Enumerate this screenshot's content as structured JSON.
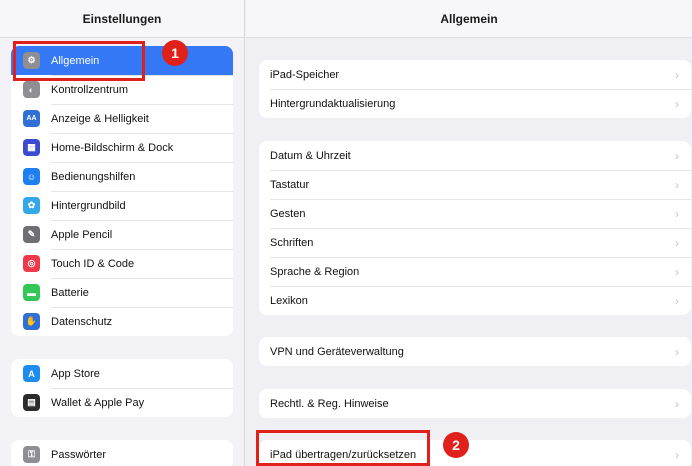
{
  "left_header": "Einstellungen",
  "right_header": "Allgemein",
  "sidebar": {
    "group1": [
      {
        "label": "Allgemein",
        "icon": "gear-icon",
        "color": "#8e8e93",
        "glyph": "⚙"
      },
      {
        "label": "Kontrollzentrum",
        "icon": "toggles-icon",
        "color": "#8e8e93",
        "glyph": "◐"
      },
      {
        "label": "Anzeige & Helligkeit",
        "icon": "text-size-icon",
        "color": "#2f6fd6",
        "glyph": "AA"
      },
      {
        "label": "Home-Bildschirm & Dock",
        "icon": "grid-icon",
        "color": "#3b4bd0",
        "glyph": "▦"
      },
      {
        "label": "Bedienungshilfen",
        "icon": "accessibility-icon",
        "color": "#1d7ff0",
        "glyph": "☺"
      },
      {
        "label": "Hintergrundbild",
        "icon": "flower-icon",
        "color": "#33a8e8",
        "glyph": "✿"
      },
      {
        "label": "Apple Pencil",
        "icon": "pencil-icon",
        "color": "#6e6e73",
        "glyph": "✎"
      },
      {
        "label": "Touch ID & Code",
        "icon": "fingerprint-icon",
        "color": "#ef3a4c",
        "glyph": "◎"
      },
      {
        "label": "Batterie",
        "icon": "battery-icon",
        "color": "#33c759",
        "glyph": "▬"
      },
      {
        "label": "Datenschutz",
        "icon": "hand-icon",
        "color": "#2f6fd6",
        "glyph": "✋"
      }
    ],
    "group2": [
      {
        "label": "App Store",
        "icon": "app-store-icon",
        "color": "#1d8cf0",
        "glyph": "A"
      },
      {
        "label": "Wallet & Apple Pay",
        "icon": "wallet-icon",
        "color": "#2b2b2b",
        "glyph": "▤"
      }
    ],
    "group3": [
      {
        "label": "Passwörter",
        "icon": "key-icon",
        "color": "#8e8e93",
        "glyph": "⚿"
      }
    ]
  },
  "main": {
    "group1": [
      "iPad-Speicher",
      "Hintergrundaktualisierung"
    ],
    "group2": [
      "Datum & Uhrzeit",
      "Tastatur",
      "Gesten",
      "Schriften",
      "Sprache & Region",
      "Lexikon"
    ],
    "group3": [
      "VPN und Geräteverwaltung"
    ],
    "group4": [
      "Rechtl. & Reg. Hinweise"
    ],
    "group5": [
      "iPad übertragen/zurücksetzen"
    ]
  },
  "chevron": "›",
  "annotations": {
    "step1": "1",
    "step2": "2",
    "color": "#e0201b"
  }
}
